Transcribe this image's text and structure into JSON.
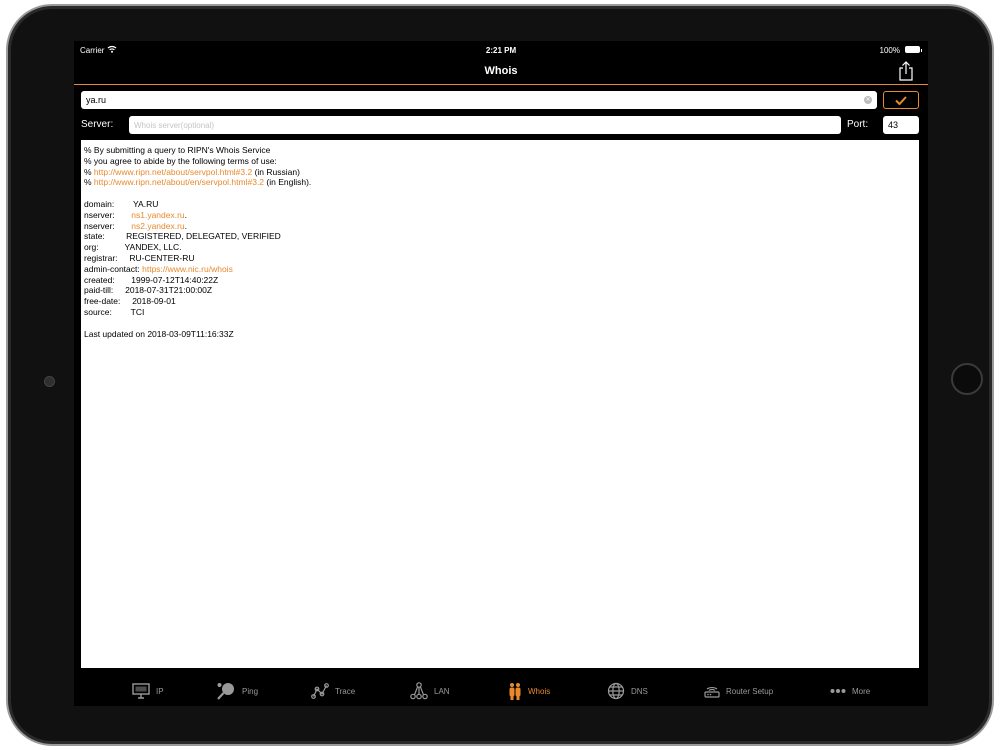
{
  "status_bar": {
    "carrier": "Carrier",
    "time": "2:21 PM",
    "battery": "100%"
  },
  "nav": {
    "title": "Whois",
    "share_icon": "share-icon"
  },
  "query": {
    "value": "ya.ru",
    "clear_icon": "clear-icon",
    "submit_icon": "checkmark-icon"
  },
  "server": {
    "label": "Server:",
    "placeholder": "Whois server(optional)",
    "value": ""
  },
  "port": {
    "label": "Port:",
    "value": "43"
  },
  "result": {
    "intro": [
      "% By submitting a query to RIPN's Whois Service",
      "% you agree to abide by the following terms of use:"
    ],
    "terms": [
      {
        "prefix": "% ",
        "link": "http://www.ripn.net/about/servpol.html#3.2",
        "suffix": " (in Russian)"
      },
      {
        "prefix": "% ",
        "link": "http://www.ripn.net/about/en/servpol.html#3.2",
        "suffix": " (in English)."
      }
    ],
    "records": [
      {
        "key": "domain:",
        "pad": "        ",
        "value": "YA.RU",
        "is_link": false,
        "suffix": ""
      },
      {
        "key": "nserver:",
        "pad": "       ",
        "value": "ns1.yandex.ru",
        "is_link": true,
        "suffix": "."
      },
      {
        "key": "nserver:",
        "pad": "       ",
        "value": "ns2.yandex.ru",
        "is_link": true,
        "suffix": "."
      },
      {
        "key": "state:",
        "pad": "         ",
        "value": "REGISTERED, DELEGATED, VERIFIED",
        "is_link": false,
        "suffix": ""
      },
      {
        "key": "org:",
        "pad": "           ",
        "value": "YANDEX, LLC.",
        "is_link": false,
        "suffix": ""
      },
      {
        "key": "registrar:",
        "pad": "     ",
        "value": "RU-CENTER-RU",
        "is_link": false,
        "suffix": ""
      },
      {
        "key": "admin-contact:",
        "pad": " ",
        "value": "https://www.nic.ru/whois",
        "is_link": true,
        "suffix": ""
      },
      {
        "key": "created:",
        "pad": "       ",
        "value": "1999-07-12T14:40:22Z",
        "is_link": false,
        "suffix": ""
      },
      {
        "key": "paid-till:",
        "pad": "     ",
        "value": "2018-07-31T21:00:00Z",
        "is_link": false,
        "suffix": ""
      },
      {
        "key": "free-date:",
        "pad": "     ",
        "value": "2018-09-01",
        "is_link": false,
        "suffix": ""
      },
      {
        "key": "source:",
        "pad": "        ",
        "value": "TCI",
        "is_link": false,
        "suffix": ""
      }
    ],
    "footer": "Last updated on 2018-03-09T11:16:33Z"
  },
  "tabs": [
    {
      "label": "IP",
      "icon": "monitor-icon",
      "active": false
    },
    {
      "label": "Ping",
      "icon": "ping-pong-icon",
      "active": false
    },
    {
      "label": "Trace",
      "icon": "trace-route-icon",
      "active": false
    },
    {
      "label": "LAN",
      "icon": "network-icon",
      "active": false
    },
    {
      "label": "Whois",
      "icon": "people-icon",
      "active": true
    },
    {
      "label": "DNS",
      "icon": "globe-icon",
      "active": false
    },
    {
      "label": "Router Setup",
      "icon": "router-icon",
      "active": false
    },
    {
      "label": "More",
      "icon": "more-dots-icon",
      "active": false
    }
  ],
  "colors": {
    "accent": "#e8892d",
    "inactive_tab": "#9a9a9a",
    "background": "#000000"
  }
}
